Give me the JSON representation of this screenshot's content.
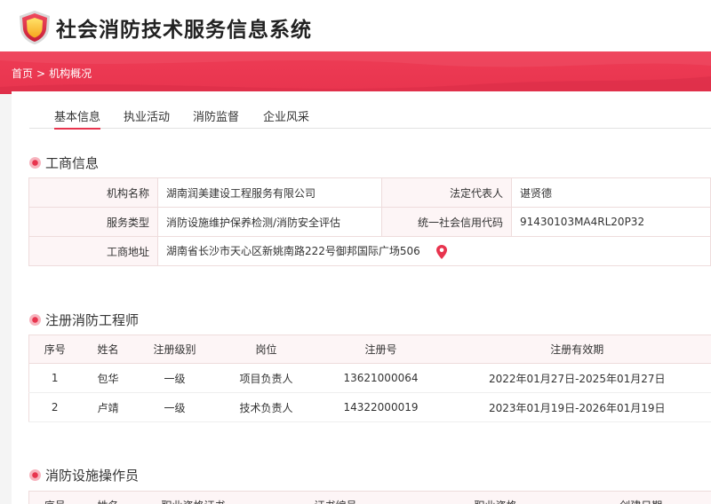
{
  "header": {
    "app_title": "社会消防技术服务信息系统"
  },
  "breadcrumb": {
    "home": "首页",
    "separator": ">",
    "current": "机构概况"
  },
  "tabs": [
    {
      "label": "基本信息",
      "active": true
    },
    {
      "label": "执业活动",
      "active": false
    },
    {
      "label": "消防监督",
      "active": false
    },
    {
      "label": "企业风采",
      "active": false
    }
  ],
  "business": {
    "title": "工商信息",
    "org_name_label": "机构名称",
    "org_name": "湖南润美建设工程服务有限公司",
    "legal_rep_label": "法定代表人",
    "legal_rep": "谌贤德",
    "service_type_label": "服务类型",
    "service_type": "消防设施维护保养检测/消防安全评估",
    "credit_code_label": "统一社会信用代码",
    "credit_code": "91430103MA4RL20P32",
    "address_label": "工商地址",
    "address": "湖南省长沙市天心区新姚南路222号御邦国际广场506"
  },
  "engineers": {
    "title": "注册消防工程师",
    "columns": [
      "序号",
      "姓名",
      "注册级别",
      "岗位",
      "注册号",
      "注册有效期"
    ],
    "rows": [
      [
        "1",
        "包华",
        "一级",
        "项目负责人",
        "13621000064",
        "2022年01月27日-2025年01月27日"
      ],
      [
        "2",
        "卢靖",
        "一级",
        "技术负责人",
        "14322000019",
        "2023年01月19日-2026年01月19日"
      ]
    ]
  },
  "operators": {
    "title": "消防设施操作员",
    "columns": [
      "序号",
      "姓名",
      "职业资格证书",
      "证书编号",
      "职业资格",
      "创建日期"
    ]
  },
  "colors": {
    "accent": "#e8344e",
    "label_bg": "#fdf5f6"
  }
}
